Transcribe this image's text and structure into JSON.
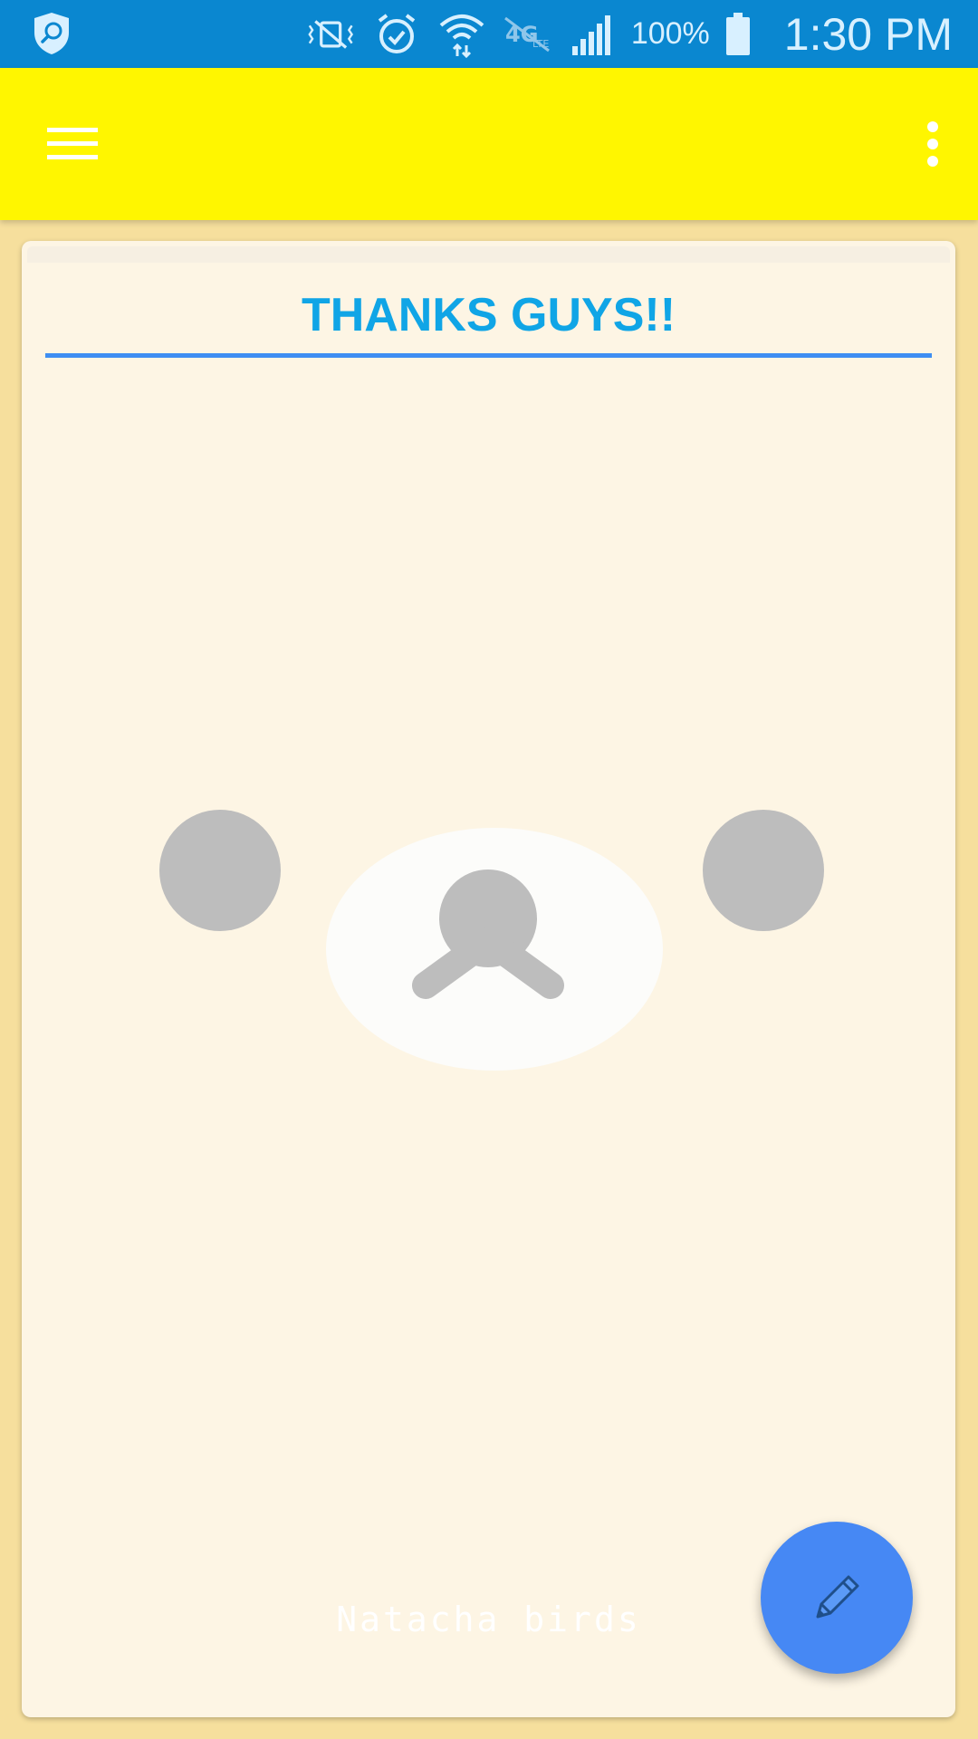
{
  "status_bar": {
    "battery_percent": "100%",
    "time": "1:30 PM",
    "icons": [
      "shield-search-icon",
      "vibrate-off-icon",
      "alarm-icon",
      "wifi-icon",
      "lte-off-icon",
      "signal-icon",
      "battery-icon"
    ]
  },
  "app_bar": {
    "background_color": "#fff600",
    "menu_icon": "hamburger-menu-icon",
    "overflow_icon": "more-vert-icon"
  },
  "card": {
    "title": "THANKS GUYS!!",
    "title_color": "#10a5e6",
    "rule_color": "#3e8ef2",
    "footer_text": "Natacha birds"
  },
  "fab": {
    "icon": "pencil-icon",
    "color": "#4688f4"
  }
}
